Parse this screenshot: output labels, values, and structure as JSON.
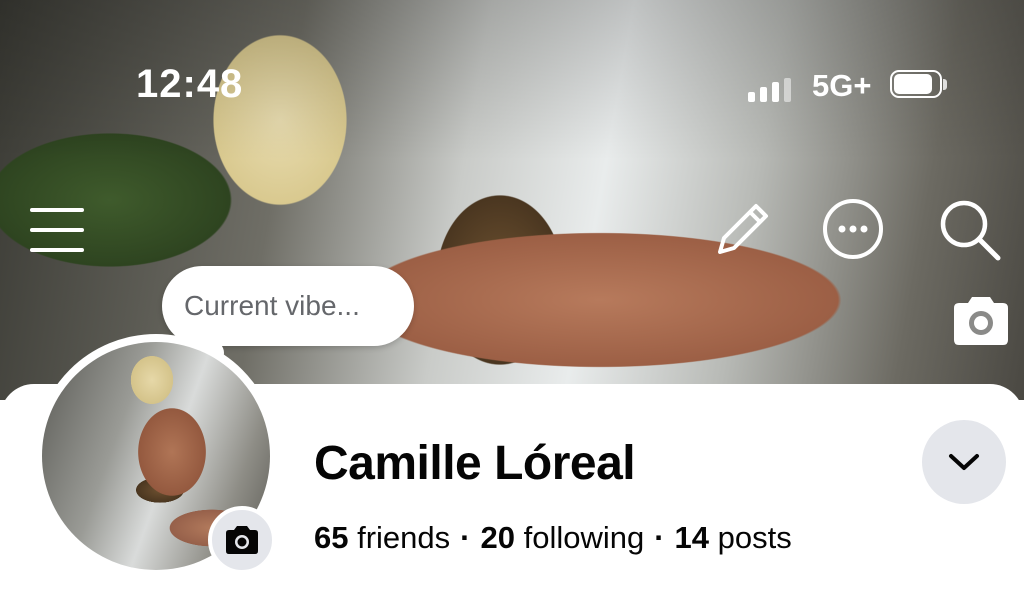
{
  "status_bar": {
    "time": "12:48",
    "network": "5G+"
  },
  "cover": {
    "icons": [
      "menu-icon",
      "pencil-icon",
      "more-icon",
      "search-icon",
      "camera-icon"
    ]
  },
  "vibe": {
    "placeholder": "Current vibe..."
  },
  "profile": {
    "name": "Camille Lóreal",
    "friends_count": "65",
    "friends_label": "friends",
    "following_count": "20",
    "following_label": "following",
    "posts_count": "14",
    "posts_label": "posts",
    "separator": "·"
  },
  "colors": {
    "panel_bg": "#ffffff",
    "button_bg": "#e4e6eb",
    "text_primary": "#050505",
    "text_secondary": "#65676b"
  }
}
